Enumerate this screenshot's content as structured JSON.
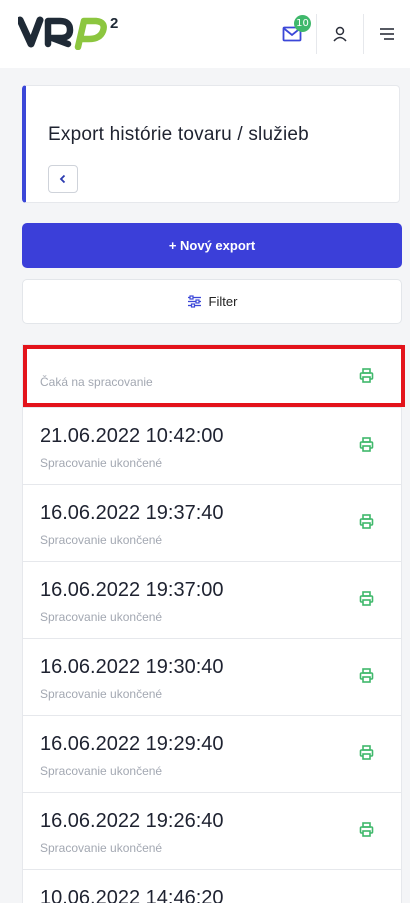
{
  "header": {
    "logo_text": "VRP²",
    "mail_badge": "10",
    "icons": [
      "mail-icon",
      "user-icon",
      "menu-icon"
    ]
  },
  "page": {
    "title": "Export histórie tovaru / služieb",
    "back_icon": "chevron-left-icon"
  },
  "actions": {
    "new_export_label": "+ Nový export",
    "filter_label": "Filter"
  },
  "colors": {
    "accent": "#3b3fd9",
    "print_icon": "#3fb86b",
    "highlight": "#e3131b"
  },
  "exports": [
    {
      "timestamp": "",
      "status": "Čaká na spracovanie"
    },
    {
      "timestamp": "21.06.2022 10:42:00",
      "status": "Spracovanie ukončené"
    },
    {
      "timestamp": "16.06.2022 19:37:40",
      "status": "Spracovanie ukončené"
    },
    {
      "timestamp": "16.06.2022 19:37:00",
      "status": "Spracovanie ukončené"
    },
    {
      "timestamp": "16.06.2022 19:30:40",
      "status": "Spracovanie ukončené"
    },
    {
      "timestamp": "16.06.2022 19:29:40",
      "status": "Spracovanie ukončené"
    },
    {
      "timestamp": "16.06.2022 19:26:40",
      "status": "Spracovanie ukončené"
    },
    {
      "timestamp": "10.06.2022 14:46:20",
      "status": ""
    }
  ]
}
